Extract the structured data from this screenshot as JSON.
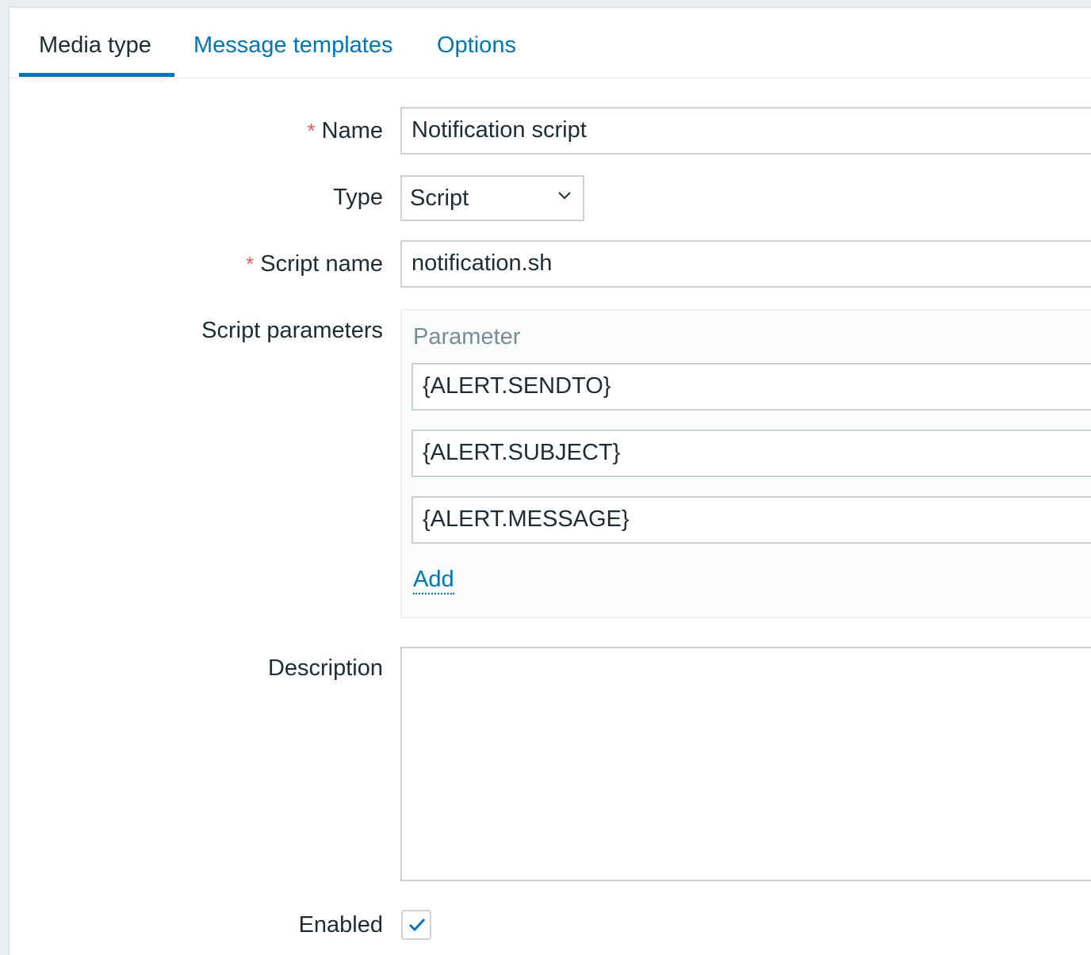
{
  "tabs": [
    {
      "label": "Media type",
      "active": true
    },
    {
      "label": "Message templates",
      "active": false
    },
    {
      "label": "Options",
      "active": false
    }
  ],
  "form": {
    "name": {
      "label": "Name",
      "required": true,
      "value": "Notification script"
    },
    "type": {
      "label": "Type",
      "value": "Script",
      "icon": "chevron-down-icon"
    },
    "script_name": {
      "label": "Script name",
      "required": true,
      "value": "notification.sh"
    },
    "script_parameters": {
      "label": "Script parameters",
      "column_header": "Parameter",
      "items": [
        "{ALERT.SENDTO}",
        "{ALERT.SUBJECT}",
        "{ALERT.MESSAGE}"
      ],
      "add_label": "Add"
    },
    "description": {
      "label": "Description",
      "value": ""
    },
    "enabled": {
      "label": "Enabled",
      "checked": true,
      "icon": "checkmark-icon"
    }
  },
  "colors": {
    "accent": "#0275b8",
    "required": "#e45959",
    "text": "#1f2c33",
    "muted": "#768d99",
    "border": "#c9d1d6",
    "background": "#ebeef0"
  }
}
